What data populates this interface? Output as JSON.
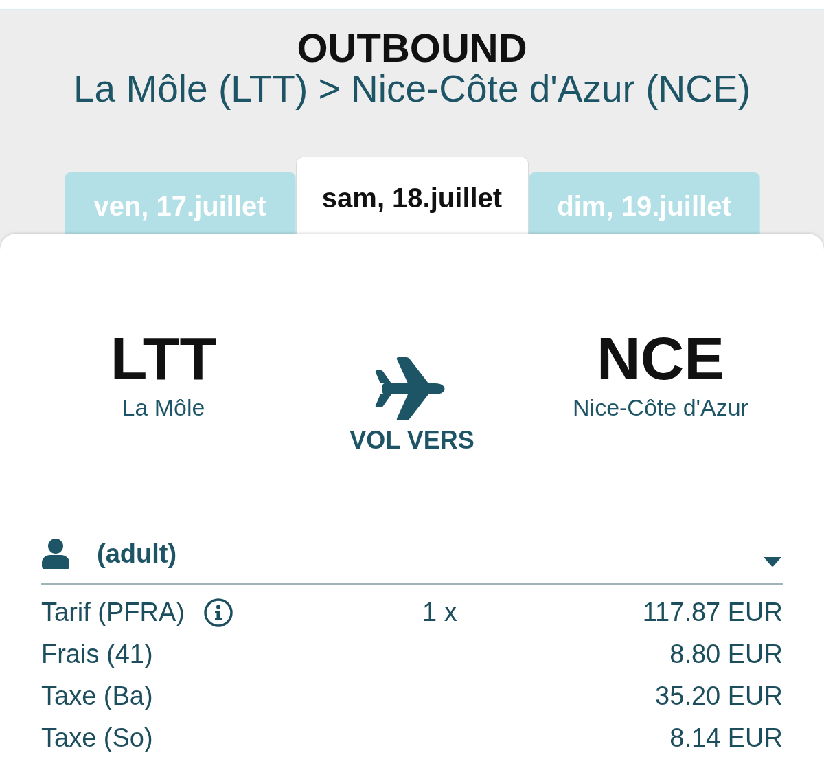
{
  "header": {
    "title": "OUTBOUND",
    "route": "La Môle (LTT) > Nice-Côte d'Azur (NCE)"
  },
  "date_tabs": [
    {
      "label": "ven, 17.juillet",
      "selected": false
    },
    {
      "label": "sam, 18.juillet",
      "selected": true
    },
    {
      "label": "dim, 19.juillet",
      "selected": false
    }
  ],
  "flight": {
    "origin": {
      "code": "LTT",
      "name": "La Môle"
    },
    "direction_label": "VOL VERS",
    "destination": {
      "code": "NCE",
      "name": "Nice-Côte d'Azur"
    }
  },
  "passenger": {
    "type": "(adult)"
  },
  "fare_lines": [
    {
      "label": "Tarif (PFRA)",
      "info": true,
      "quantity": "1 x",
      "amount": "117.87 EUR"
    },
    {
      "label": "Frais (41)",
      "info": false,
      "amount": "8.80 EUR"
    },
    {
      "label": "Taxe (Ba)",
      "info": false,
      "amount": "35.20 EUR"
    },
    {
      "label": "Taxe (So)",
      "info": false,
      "amount": "8.14 EUR"
    }
  ]
}
